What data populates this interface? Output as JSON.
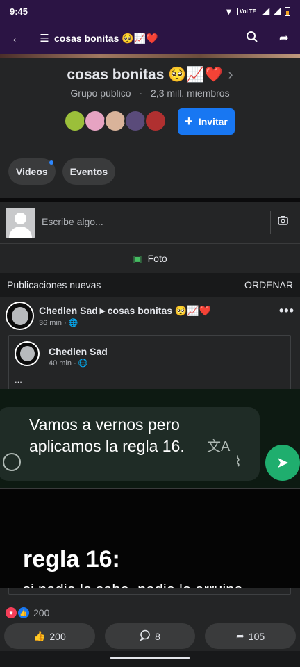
{
  "status": {
    "time": "9:45",
    "icons": [
      "wifi-icon",
      "volte-icon",
      "signal-icon",
      "signal-icon",
      "battery-icon"
    ],
    "volte": "VoLTE"
  },
  "appbar": {
    "title": "cosas bonitas 🥺📈❤️"
  },
  "group": {
    "name": "cosas bonitas 🥺📈❤️",
    "privacy": "Grupo público",
    "dot": "·",
    "members": "2,3 mill. miembros",
    "invite_label": "Invitar",
    "avatar_colors": [
      "#9bbf3a",
      "#e6a3c2",
      "#d9b39a",
      "#5a4b7a",
      "#b03030"
    ]
  },
  "tabs": [
    {
      "label": "Videos",
      "badge": true
    },
    {
      "label": "Eventos",
      "badge": false
    }
  ],
  "composer": {
    "placeholder": "Escribe algo...",
    "photo_label": "Foto"
  },
  "feed": {
    "header": "Publicaciones nuevas",
    "sort_label": "ORDENAR"
  },
  "post": {
    "author": "Chedlen Sad►cosas bonitas 🥺📈❤️",
    "time": "36 min",
    "dot": "·",
    "shared": {
      "author": "Chedlen Sad",
      "time": "40 min",
      "dot": "·",
      "text": "..."
    },
    "meme": {
      "bubble_text": "Vamos a vernos pero aplicamos la regla 16.",
      "heading": "regla 16:",
      "caption": "si nadie lo sabe, nadie lo arruina"
    },
    "reactions_count": "200",
    "actions": {
      "like": "200",
      "comment": "8",
      "share": "105"
    }
  },
  "colors": {
    "brand_bar": "#2b1444",
    "accent": "#1877f2",
    "card": "#242526",
    "photo_green": "#45bd62"
  }
}
